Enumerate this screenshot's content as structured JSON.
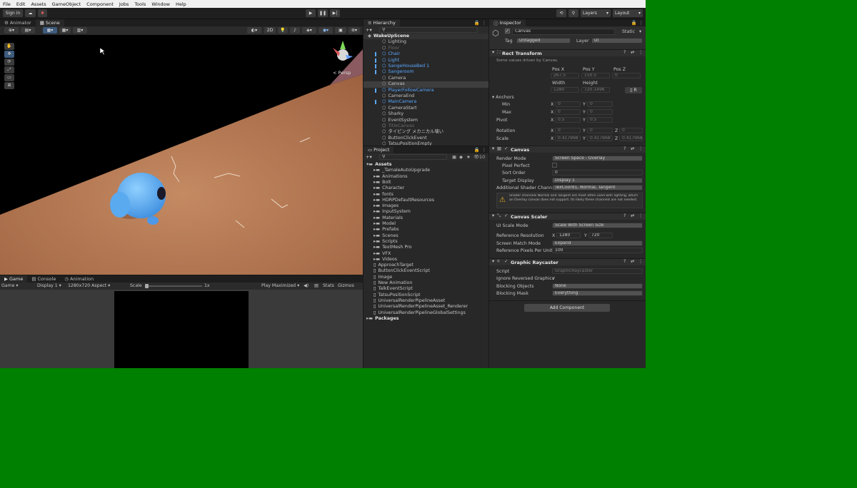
{
  "menu": [
    "File",
    "Edit",
    "Assets",
    "GameObject",
    "Component",
    "Jobs",
    "Tools",
    "Window",
    "Help"
  ],
  "toolbar": {
    "signin": "Sign in",
    "layers": "Layers",
    "layout": "Layout"
  },
  "scene": {
    "tabs": [
      "Animator",
      "Scene"
    ],
    "mode_2d": "2D",
    "gizmo_label": "< Persp"
  },
  "hierarchy": {
    "title": "Hierarchy",
    "items": [
      {
        "label": "WakeUpScene",
        "style": "bold",
        "indent": 0
      },
      {
        "label": "Lighting",
        "style": "normal",
        "indent": 1
      },
      {
        "label": "Floor",
        "style": "dim",
        "indent": 1
      },
      {
        "label": "Chair",
        "style": "blue",
        "indent": 1
      },
      {
        "label": "Light",
        "style": "blue",
        "indent": 1
      },
      {
        "label": "SangeHouseBed 1",
        "style": "blue",
        "indent": 1
      },
      {
        "label": "Sangeroom",
        "style": "blue",
        "indent": 1
      },
      {
        "label": "Camera",
        "style": "normal",
        "indent": 1
      },
      {
        "label": "Canvas",
        "style": "selected",
        "indent": 1
      },
      {
        "label": "PlayerFollowCamera",
        "style": "blue",
        "indent": 1
      },
      {
        "label": "CameraEnd",
        "style": "normal",
        "indent": 1
      },
      {
        "label": "MainCamera",
        "style": "blue",
        "indent": 1
      },
      {
        "label": "CameraStart",
        "style": "normal",
        "indent": 1
      },
      {
        "label": "Sharky",
        "style": "normal",
        "indent": 1
      },
      {
        "label": "EventSystem",
        "style": "normal",
        "indent": 1
      },
      {
        "label": "TitleCanvas",
        "style": "dim",
        "indent": 1
      },
      {
        "label": "タイピング メカニカル壊い",
        "style": "normal",
        "indent": 1
      },
      {
        "label": "ButtonClickEvent",
        "style": "normal",
        "indent": 1
      },
      {
        "label": "TatsuPositionEmpty",
        "style": "normal",
        "indent": 1
      }
    ]
  },
  "project": {
    "title": "Project",
    "count": "10",
    "root": "Assets",
    "folders": [
      "_TamaleAutoUpgrade",
      "Animations",
      "Bolt",
      "Character",
      "fonts",
      "HDRPDefaultResources",
      "Images",
      "InputSystem",
      "Materials",
      "Model",
      "Prefabs",
      "Scenes",
      "Scripts",
      "TextMesh Pro",
      "VFX",
      "Videos"
    ],
    "files": [
      "ApproachTarget",
      "ButtonClickEventScript",
      "Image",
      "New Animation",
      "TalkEventScript",
      "TatsuPositionScript",
      "UniversalRenderPipelineAsset",
      "UniversalRenderPipelineAsset_Renderer",
      "UniversalRenderPipelineGlobalSettings"
    ],
    "packages": "Packages"
  },
  "game": {
    "tabs": [
      "Game",
      "Console",
      "Animation"
    ],
    "game_label": "Game",
    "display": "Display 1",
    "aspect": "1280x720 Aspect",
    "scale_label": "Scale",
    "scale_value": "1x",
    "play_mode": "Play Maximized",
    "stats": "Stats",
    "gizmos": "Gizmos"
  },
  "inspector": {
    "title": "Inspector",
    "object_name": "Canvas",
    "static_label": "Static",
    "tag_label": "Tag",
    "tag_value": "Untagged",
    "layer_label": "Layer",
    "layer_value": "UI",
    "rect": {
      "title": "Rect Transform",
      "note": "Some values driven by Canvas.",
      "pos_x_label": "Pos X",
      "pos_y_label": "Pos Y",
      "pos_z_label": "Pos Z",
      "pos_x": "267.5",
      "pos_y": "150.5",
      "pos_z": "0",
      "width_label": "Width",
      "height_label": "Height",
      "width": "1280",
      "height": "720.1496",
      "anchors": "Anchors",
      "min": "Min",
      "max": "Max",
      "min_x": "0",
      "min_y": "0",
      "max_x": "0",
      "max_y": "0",
      "pivot": "Pivot",
      "pivot_x": "0.5",
      "pivot_y": "0.5",
      "rotation": "Rotation",
      "rot_x": "0",
      "rot_y": "0",
      "rot_z": "0",
      "scale": "Scale",
      "scale_x": "0.417968",
      "scale_y": "0.417968",
      "scale_z": "0.417968"
    },
    "canvas": {
      "title": "Canvas",
      "render_mode_label": "Render Mode",
      "render_mode": "Screen Space - Overlay",
      "pixel_perfect": "Pixel Perfect",
      "sort_order_label": "Sort Order",
      "sort_order": "0",
      "target_display_label": "Target Display",
      "target_display": "Display 1",
      "shader_label": "Additional Shader Chann",
      "shader_value": "TexCoord1, Normal, Tangent",
      "warning": "Shader channels Normal and Tangent are most often used with lighting, which an Overlay canvas does not support. Its likely these channels are not needed."
    },
    "scaler": {
      "title": "Canvas Scaler",
      "ui_scale_label": "UI Scale Mode",
      "ui_scale": "Scale With Screen Size",
      "ref_res_label": "Reference Resolution",
      "ref_x": "1280",
      "ref_y": "720",
      "match_label": "Screen Match Mode",
      "match": "Expand",
      "ppu_label": "Reference Pixels Per Unit",
      "ppu": "100"
    },
    "raycaster": {
      "title": "Graphic Raycaster",
      "script_label": "Script",
      "script": "GraphicRaycaster",
      "ignore_label": "Ignore Reversed Graphics",
      "blocking_obj_label": "Blocking Objects",
      "blocking_obj": "None",
      "blocking_mask_label": "Blocking Mask",
      "blocking_mask": "Everything"
    },
    "add_component": "Add Component"
  },
  "colors": {
    "accent": "#5aa8ff",
    "selected": "#2c5d87",
    "green_bg": "#008000",
    "warning": "#e8b21b"
  }
}
